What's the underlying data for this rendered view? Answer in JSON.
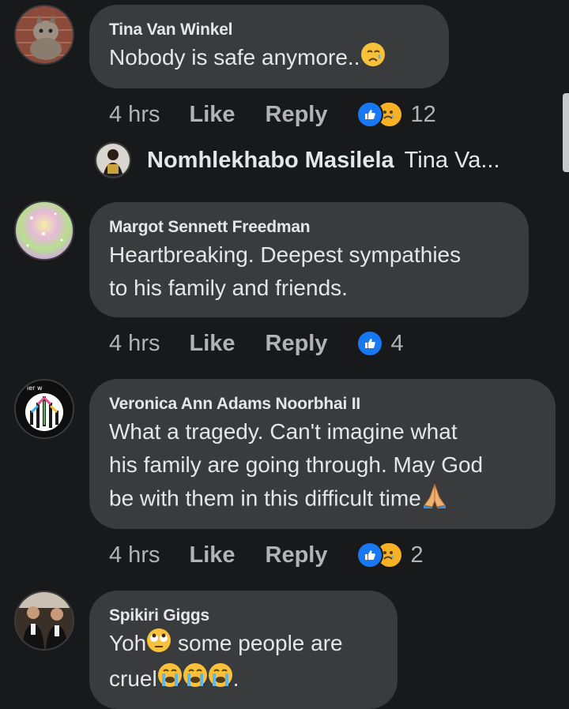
{
  "comments": [
    {
      "author": "Tina Van Winkel",
      "text": "Nobody is safe anymore..",
      "time": "4 hrs",
      "like_label": "Like",
      "reply_label": "Reply",
      "reaction_count": "12",
      "reactions": [
        "like-icon",
        "sad-icon"
      ],
      "trailing_emoji": "sad-face-emoji"
    },
    {
      "author": "Margot Sennett Freedman",
      "text_lines": [
        "Heartbreaking. Deepest sympathies",
        "to his family and friends."
      ],
      "time": "4 hrs",
      "like_label": "Like",
      "reply_label": "Reply",
      "reaction_count": "4",
      "reactions": [
        "like-icon"
      ]
    },
    {
      "author": "Veronica Ann Adams Noorbhai II",
      "text_lines": [
        "What a tragedy. Can't imagine what",
        "his family are going through. May God",
        "be with them in this difficult time"
      ],
      "time": "4 hrs",
      "like_label": "Like",
      "reply_label": "Reply",
      "reaction_count": "2",
      "reactions": [
        "like-icon",
        "sad-icon"
      ],
      "trailing_emoji": "praying-hands-emoji"
    },
    {
      "author": "Spikiri Giggs",
      "text_lines": [
        "Yoh",
        " some people are",
        "cruel",
        "."
      ],
      "emojis": [
        "eye-roll-emoji",
        "crying-face-emoji"
      ]
    }
  ],
  "reply_preview": {
    "author": "Nomhlekhabo Masilela",
    "snippet": "Tina Va..."
  },
  "colors": {
    "background": "#18191a",
    "bubble": "#3a3b3c",
    "like": "#1877f2",
    "sad": "#f7b125",
    "secondary_text": "#b0b3b8"
  }
}
